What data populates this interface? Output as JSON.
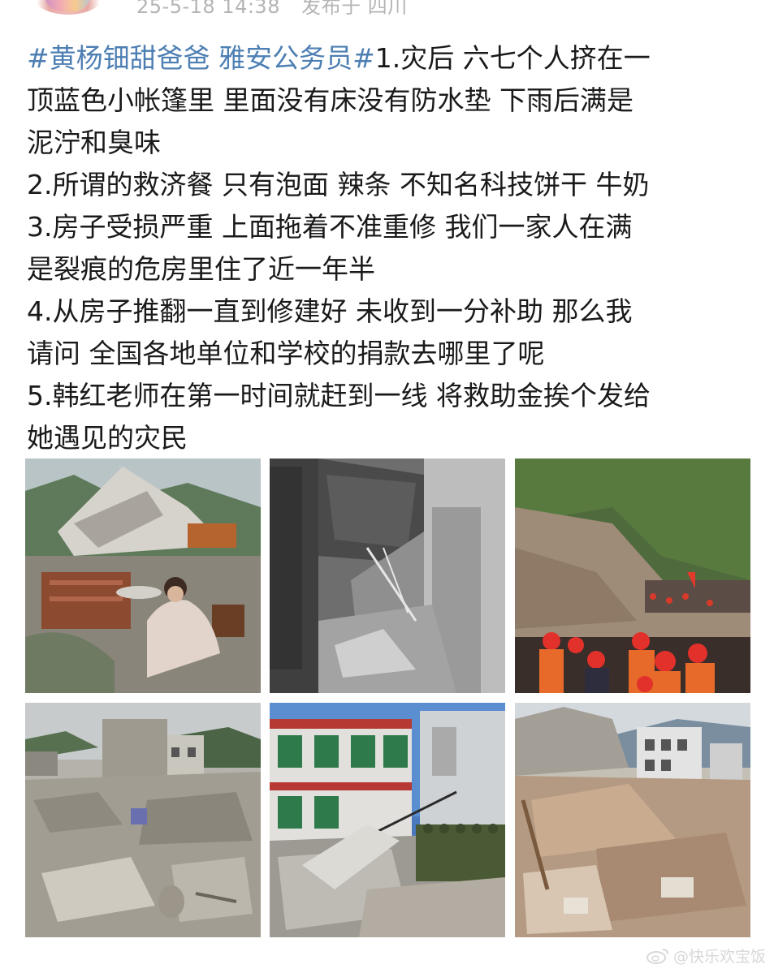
{
  "header": {
    "date": "25-5-18 14:38",
    "location": "发布于 四川"
  },
  "post": {
    "hashtags": "#黄杨钿甜爸爸 雅安公务员#",
    "lines": [
      "1.灾后 六七个人挤在一",
      "顶蓝色小帐篷里 里面没有床没有防水垫 下雨后满是",
      "泥泞和臭味",
      "2.所谓的救济餐 只有泡面 辣条 不知名科技饼干 牛奶",
      "3.房子受损严重 上面拖着不准重修 我们一家人在满",
      "是裂痕的危房里住了近一年半",
      "4.从房子推翻一直到修建好 未收到一分补助 那么我",
      "请问 全国各地单位和学校的捐款去哪里了呢",
      "5.韩红老师在第一时间就赶到一线 将救助金挨个发给",
      "她遇见的灾民"
    ]
  },
  "photos": [
    {
      "icon": "earthquake-photo-woman-rubble-icon"
    },
    {
      "icon": "earthquake-photo-collapsed-alley-icon"
    },
    {
      "icon": "earthquake-photo-rescue-workers-icon"
    },
    {
      "icon": "earthquake-photo-destroyed-buildings-icon"
    },
    {
      "icon": "earthquake-photo-damaged-school-icon"
    },
    {
      "icon": "earthquake-photo-rubble-field-icon"
    }
  ],
  "watermark": {
    "text": "@快乐欢宝饭"
  },
  "colors": {
    "hashtag": "#4d7fb3",
    "meta": "#b4b4b4",
    "body_text": "#1a1a1a"
  }
}
